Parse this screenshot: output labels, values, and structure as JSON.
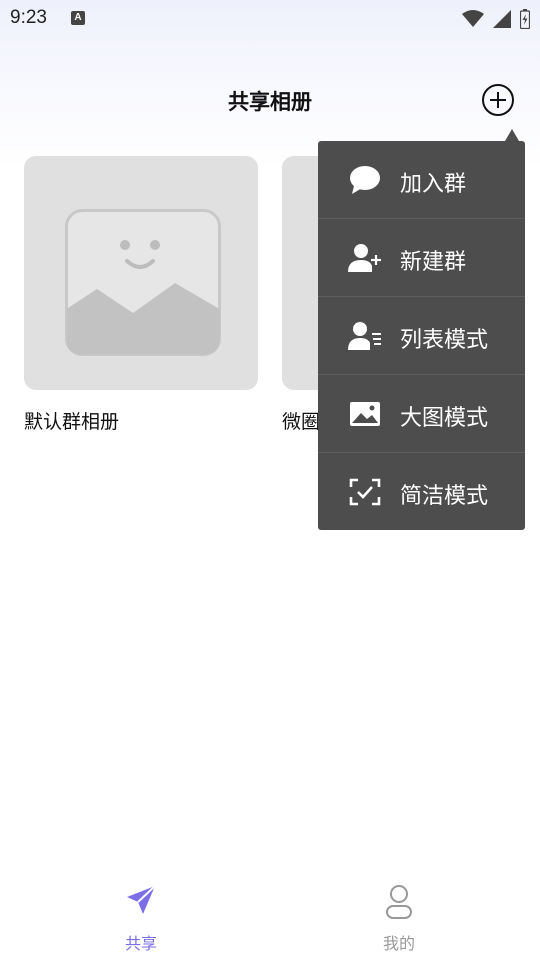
{
  "status_bar": {
    "time": "9:23",
    "notification_badge": "A"
  },
  "header": {
    "title": "共享相册",
    "add_icon": "plus-circle-icon"
  },
  "albums": [
    {
      "name": "默认群相册"
    },
    {
      "name": "微圈"
    }
  ],
  "menu": {
    "items": [
      {
        "label": "加入群",
        "icon": "chat-bubble-icon"
      },
      {
        "label": "新建群",
        "icon": "user-plus-icon"
      },
      {
        "label": "列表模式",
        "icon": "user-list-icon"
      },
      {
        "label": "大图模式",
        "icon": "image-icon"
      },
      {
        "label": "简洁模式",
        "icon": "scan-check-icon"
      }
    ]
  },
  "bottom_nav": {
    "tabs": [
      {
        "label": "共享",
        "icon": "paper-plane-icon",
        "active": true
      },
      {
        "label": "我的",
        "icon": "person-icon",
        "active": false
      }
    ]
  },
  "colors": {
    "accent": "#7b6ee6",
    "menu_background": "#4d4d4d",
    "inactive_tab": "#999999"
  }
}
